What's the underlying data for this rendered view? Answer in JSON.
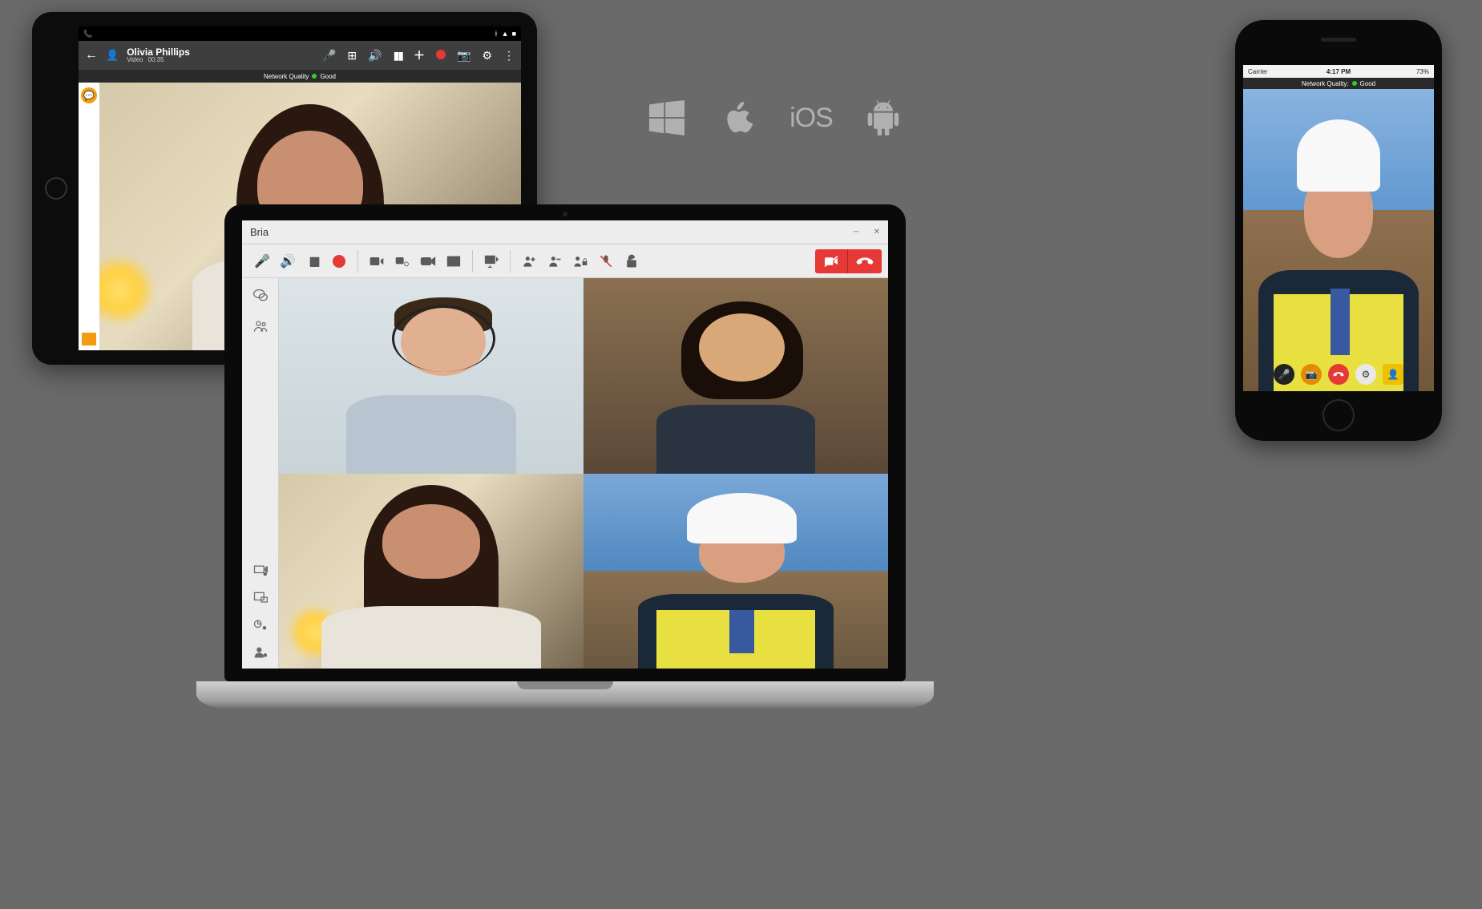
{
  "tablet": {
    "caller_name": "Olivia Phillips",
    "call_type": "Video",
    "duration": "00:35",
    "network_label": "Network Quality",
    "network_status": "Good"
  },
  "laptop": {
    "app_title": "Bria"
  },
  "phone": {
    "carrier": "Carrier",
    "time": "4:17 PM",
    "battery": "73%",
    "network_label": "Network Quality:",
    "network_status": "Good"
  },
  "platforms": {
    "ios_label": "iOS"
  }
}
